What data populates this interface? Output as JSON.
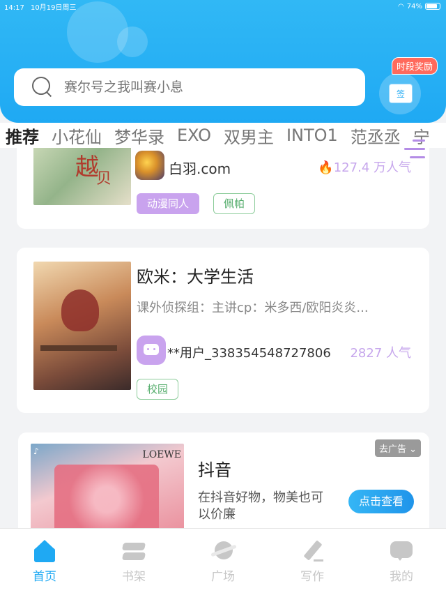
{
  "status_bar": {
    "time": "14:17",
    "date": "10月19日周三",
    "battery": "74%"
  },
  "search": {
    "placeholder": "赛尔号之我叫赛小息"
  },
  "sign_in": {
    "badge": "时段奖励",
    "label": "签"
  },
  "tabs": [
    {
      "label": "推荐",
      "active": true
    },
    {
      "label": "小花仙"
    },
    {
      "label": "梦华录"
    },
    {
      "label": "EXO"
    },
    {
      "label": "双男主"
    },
    {
      "label": "INTO1"
    },
    {
      "label": "范丞丞"
    },
    {
      "label": "宁"
    }
  ],
  "cards": [
    {
      "author": "白羽.com",
      "popularity": "127.4 万人气",
      "tags": [
        "动漫同人",
        "佩帕"
      ]
    },
    {
      "title": "欧米：大学生活",
      "description": "课外侦探组：主讲cp：米多西/欧阳炎炎...",
      "author": "**用户_338354548727806",
      "popularity": "2827 人气",
      "tags": [
        "校园"
      ]
    }
  ],
  "ad": {
    "title": "抖音",
    "description_line1": "在抖音好物，物美也可",
    "description_line2": "以价廉",
    "button": "点击查看",
    "close_label": "去广告 ⌄"
  },
  "bottom_nav": [
    {
      "label": "首页",
      "icon": "home-icon",
      "active": true
    },
    {
      "label": "书架",
      "icon": "bookshelf-icon"
    },
    {
      "label": "广场",
      "icon": "planet-icon"
    },
    {
      "label": "写作",
      "icon": "pen-icon"
    },
    {
      "label": "我的",
      "icon": "chat-bubble-icon"
    }
  ],
  "colors": {
    "primary": "#1fa9f3",
    "accent_purple": "#c9a3ee",
    "tag_green": "#55ad6c",
    "badge_red": "#ff6a5c"
  }
}
